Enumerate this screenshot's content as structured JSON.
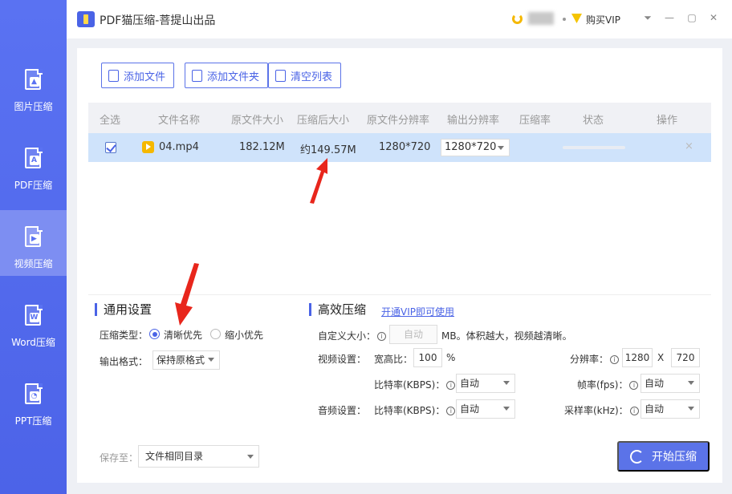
{
  "app": {
    "title": "PDF猫压缩-菩提山出品"
  },
  "topbar": {
    "vip_label": "购买VIP"
  },
  "sidebar": {
    "items": [
      {
        "label": "图片压缩",
        "icon": "image-file-icon"
      },
      {
        "label": "PDF压缩",
        "icon": "pdf-file-icon"
      },
      {
        "label": "视频压缩",
        "icon": "video-file-icon",
        "active": true
      },
      {
        "label": "Word压缩",
        "icon": "word-file-icon"
      },
      {
        "label": "PPT压缩",
        "icon": "ppt-file-icon"
      }
    ]
  },
  "toolbar": {
    "add_file": "添加文件",
    "add_folder": "添加文件夹",
    "clear_list": "清空列表"
  },
  "table": {
    "headers": {
      "select_all": "全选",
      "name": "文件名称",
      "orig_size": "原文件大小",
      "compressed_size": "压缩后大小",
      "orig_res": "原文件分辨率",
      "out_res": "输出分辨率",
      "ratio": "压缩率",
      "status": "状态",
      "action": "操作"
    },
    "rows": [
      {
        "name": "04.mp4",
        "orig_size": "182.12M",
        "compressed_size": "约149.57M",
        "orig_res": "1280*720",
        "out_res": "1280*720",
        "ratio": "",
        "action_close": "×"
      }
    ]
  },
  "general": {
    "title": "通用设置",
    "type_label": "压缩类型：",
    "opt_clear": "清晰优先",
    "opt_small": "缩小优先",
    "format_label": "输出格式：",
    "format_value": "保持原格式"
  },
  "efficient": {
    "title": "高效压缩",
    "vip_link": "开通VIP即可使用",
    "custom_size_label": "自定义大小：",
    "custom_size_value": "自动",
    "custom_size_hint": "MB。体积越大，视频越清晰。",
    "video_label": "视频设置：",
    "aspect_label": "宽高比：",
    "aspect_value": "100",
    "aspect_unit": "%",
    "res_label": "分辨率：",
    "res_w": "1280",
    "res_x": "X",
    "res_h": "720",
    "bitrate_label": "比特率(KBPS)：",
    "bitrate_value": "自动",
    "fps_label": "帧率(fps)：",
    "fps_value": "自动",
    "audio_label": "音频设置：",
    "audio_bitrate_label": "比特率(KBPS)：",
    "audio_bitrate_value": "自动",
    "sample_label": "采样率(kHz)：",
    "sample_value": "自动"
  },
  "footer": {
    "save_label": "保存至：",
    "save_value": "文件相同目录",
    "start_button": "开始压缩"
  },
  "colors": {
    "accent": "#4a63e6",
    "sidebar": "#5a72f2",
    "row_selected": "#cfe3fb",
    "arrow": "#e8261c"
  }
}
